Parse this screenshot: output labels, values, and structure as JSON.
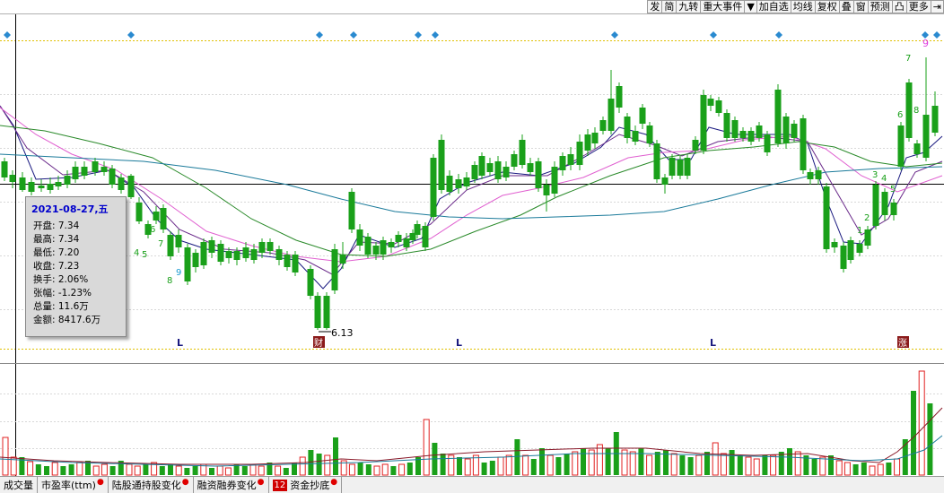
{
  "toolbar": {
    "buttons": [
      "发",
      "简",
      "九转",
      "重大事件",
      "▼",
      "加自选",
      "均线",
      "复权",
      "叠",
      "窗",
      "预测",
      "凸",
      "更多",
      "⇥"
    ]
  },
  "tooltip": {
    "date": "2021-08-27,五",
    "rows": [
      "开盘: 7.34",
      "最高: 7.34",
      "最低: 7.20",
      "收盘: 7.23",
      "换手: 2.06%",
      "张幅: -1.23%",
      "总量: 11.6万",
      "金额: 8417.6万"
    ]
  },
  "annotations": {
    "low_price": "6.13",
    "markers_L": [
      "L",
      "L",
      "L"
    ],
    "tag_cai": "财",
    "tag_zhang": "涨",
    "nine_turn_top": "9",
    "nine_turn_labels_green": [
      "4",
      "5",
      "6",
      "7",
      "8"
    ],
    "nine_turn_label_blue": "9",
    "nine_turn_labels_right": [
      "1",
      "2",
      "3",
      "4",
      "5",
      "6",
      "7",
      "8"
    ]
  },
  "tabs": [
    {
      "label": "成交量",
      "dot": false,
      "num": ""
    },
    {
      "label": "市盈率(ttm)",
      "dot": true,
      "num": ""
    },
    {
      "label": "陆股通持股变化",
      "dot": true,
      "num": ""
    },
    {
      "label": "融资融券变化",
      "dot": true,
      "num": ""
    },
    {
      "label": "资金抄底",
      "dot": true,
      "num": "12"
    }
  ],
  "colors": {
    "up": "#e02020",
    "down": "#1aa01a",
    "ma5": "#1a1a80",
    "ma10": "#a020a0",
    "ma20": "#2a8a2a",
    "ma30": "#e060d0",
    "ma60": "#1a7a9a",
    "dotted": "#e0c000",
    "diamond": "#2a8ad0"
  }
}
